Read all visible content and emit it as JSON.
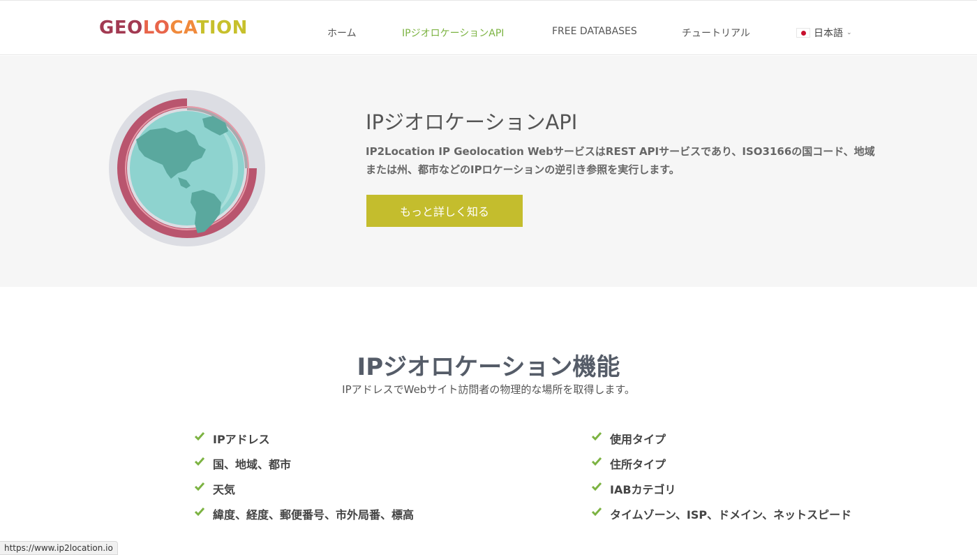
{
  "header": {
    "logo_parts": [
      {
        "text": "GEO",
        "color": "#a23a52"
      },
      {
        "text": "LO",
        "color": "#e8654a"
      },
      {
        "text": "CA",
        "color": "#f08a3c"
      },
      {
        "text": "TION",
        "color": "#c7c02c"
      }
    ],
    "nav": [
      {
        "label": "ホーム",
        "active": false
      },
      {
        "label": "IPジオロケーションAPI",
        "active": true
      },
      {
        "label": "FREE DATABASES",
        "active": false
      },
      {
        "label": "チュートリアル",
        "active": false
      }
    ],
    "language": {
      "label": "日本語",
      "icon": "japan-flag-icon"
    }
  },
  "hero": {
    "title": "IPジオロケーションAPI",
    "description": "IP2Location IP Geolocation WebサービスはREST APIサービスであり、ISO3166の国コード、地域または州、都市などのIPロケーションの逆引き参照を実行します。",
    "button_label": "もっと詳しく知る",
    "button_color": "#c4bd2d"
  },
  "features": {
    "title": "IPジオロケーション機能",
    "subtitle": "IPアドレスでWebサイト訪問者の物理的な場所を取得します。",
    "left": [
      "IPアドレス",
      "国、地域、都市",
      "天気",
      "緯度、経度、郵便番号、市外局番、標高"
    ],
    "right": [
      "使用タイプ",
      "住所タイプ",
      "IABカテゴリ",
      "タイムゾーン、ISP、ドメイン、ネットスピード"
    ],
    "check_color": "#7cb342"
  },
  "status_bar": {
    "url": "https://www.ip2location.io"
  }
}
